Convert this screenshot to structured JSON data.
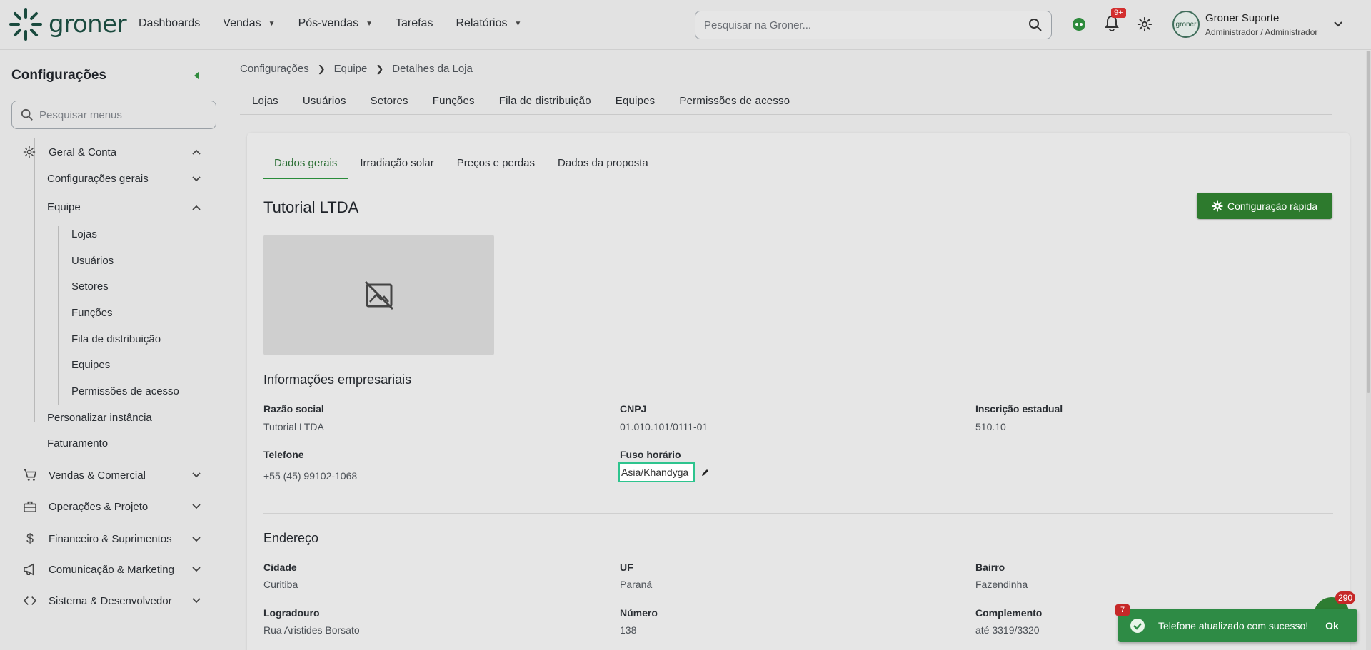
{
  "header": {
    "logo_text": "groner",
    "nav": [
      {
        "label": "Dashboards",
        "dropdown": false
      },
      {
        "label": "Vendas",
        "dropdown": true
      },
      {
        "label": "Pós-vendas",
        "dropdown": true
      },
      {
        "label": "Tarefas",
        "dropdown": false
      },
      {
        "label": "Relatórios",
        "dropdown": true
      }
    ],
    "search_placeholder": "Pesquisar na Groner...",
    "notification_badge": "9+",
    "user_name": "Groner Suporte",
    "user_role": "Administrador / Administrador",
    "avatar_text": "groner"
  },
  "sidebar": {
    "title": "Configurações",
    "search_placeholder": "Pesquisar menus",
    "items": [
      {
        "label": "Geral & Conta",
        "icon": "gear-icon"
      },
      {
        "label": "Configurações gerais"
      },
      {
        "label": "Equipe"
      },
      {
        "label": "Lojas"
      },
      {
        "label": "Usuários"
      },
      {
        "label": "Setores"
      },
      {
        "label": "Funções"
      },
      {
        "label": "Fila de distribuição"
      },
      {
        "label": "Equipes"
      },
      {
        "label": "Permissões de acesso"
      },
      {
        "label": "Personalizar instância"
      },
      {
        "label": "Faturamento"
      },
      {
        "label": "Vendas & Comercial",
        "icon": "cart-icon"
      },
      {
        "label": "Operações & Projeto",
        "icon": "briefcase-icon"
      },
      {
        "label": "Financeiro & Suprimentos",
        "icon": "dollar-icon"
      },
      {
        "label": "Comunicação & Marketing",
        "icon": "megaphone-icon"
      },
      {
        "label": "Sistema & Desenvolvedor",
        "icon": "code-icon"
      }
    ]
  },
  "breadcrumb": [
    "Configurações",
    "Equipe",
    "Detalhes da Loja"
  ],
  "tabs": [
    "Lojas",
    "Usuários",
    "Setores",
    "Funções",
    "Fila de distribuição",
    "Equipes",
    "Permissões de acesso"
  ],
  "subtabs": [
    "Dados gerais",
    "Irradiação solar",
    "Preços e perdas",
    "Dados da proposta"
  ],
  "store": {
    "title": "Tutorial LTDA",
    "quick_config_label": "Configuração rápida"
  },
  "company_info": {
    "section_title": "Informações empresariais",
    "razao_social_label": "Razão social",
    "razao_social": "Tutorial LTDA",
    "cnpj_label": "CNPJ",
    "cnpj": "01.010.101/0111-01",
    "ie_label": "Inscrição estadual",
    "ie": "510.10",
    "telefone_label": "Telefone",
    "telefone": "+55 (45) 99102-1068",
    "fuso_label": "Fuso horário",
    "fuso_value": "Asia/Khandyga"
  },
  "address": {
    "section_title": "Endereço",
    "cidade_label": "Cidade",
    "cidade": "Curitiba",
    "uf_label": "UF",
    "uf": "Paraná",
    "bairro_label": "Bairro",
    "bairro": "Fazendinha",
    "logradouro_label": "Logradouro",
    "logradouro": "Rua Aristides Borsato",
    "numero_label": "Número",
    "numero": "138",
    "complemento_label": "Complemento",
    "complemento": "até 3319/3320"
  },
  "toast": {
    "message": "Telefone atualizado com sucesso!",
    "ok_label": "Ok",
    "badge": "7"
  },
  "chat_badge": "290",
  "colors": {
    "accent_green": "#2d7a2d",
    "toast_green": "#2e8b45",
    "badge_red": "#d32f2f",
    "focus_border": "#2ec48e"
  }
}
